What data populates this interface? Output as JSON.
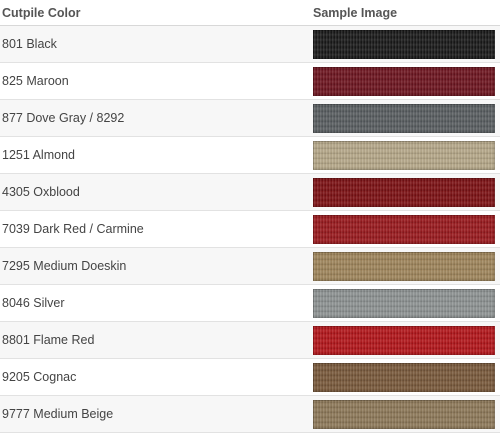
{
  "table": {
    "header": {
      "col1": "Cutpile Color",
      "col2": "Sample Image"
    },
    "rows": [
      {
        "name": "801 Black",
        "swatch_color": "#1a1a1a",
        "swatch_icon": "black-carpet-swatch"
      },
      {
        "name": "825 Maroon",
        "swatch_color": "#6e1520",
        "swatch_icon": "maroon-carpet-swatch"
      },
      {
        "name": "877 Dove Gray / 8292",
        "swatch_color": "#5a5f62",
        "swatch_icon": "dove-gray-carpet-swatch"
      },
      {
        "name": "1251 Almond",
        "swatch_color": "#b7a98a",
        "swatch_icon": "almond-carpet-swatch"
      },
      {
        "name": "4305 Oxblood",
        "swatch_color": "#7d1114",
        "swatch_icon": "oxblood-carpet-swatch"
      },
      {
        "name": "7039 Dark Red / Carmine",
        "swatch_color": "#9a1a1e",
        "swatch_icon": "dark-red-carpet-swatch"
      },
      {
        "name": "7295 Medium Doeskin",
        "swatch_color": "#a0865c",
        "swatch_icon": "doeskin-carpet-swatch"
      },
      {
        "name": "8046 Silver",
        "swatch_color": "#8f9494",
        "swatch_icon": "silver-carpet-swatch"
      },
      {
        "name": "8801 Flame Red",
        "swatch_color": "#b4161b",
        "swatch_icon": "flame-red-carpet-swatch"
      },
      {
        "name": "9205 Cognac",
        "swatch_color": "#7a5a3c",
        "swatch_icon": "cognac-carpet-swatch"
      },
      {
        "name": "9777 Medium Beige",
        "swatch_color": "#8f7a5a",
        "swatch_icon": "beige-carpet-swatch"
      }
    ]
  }
}
